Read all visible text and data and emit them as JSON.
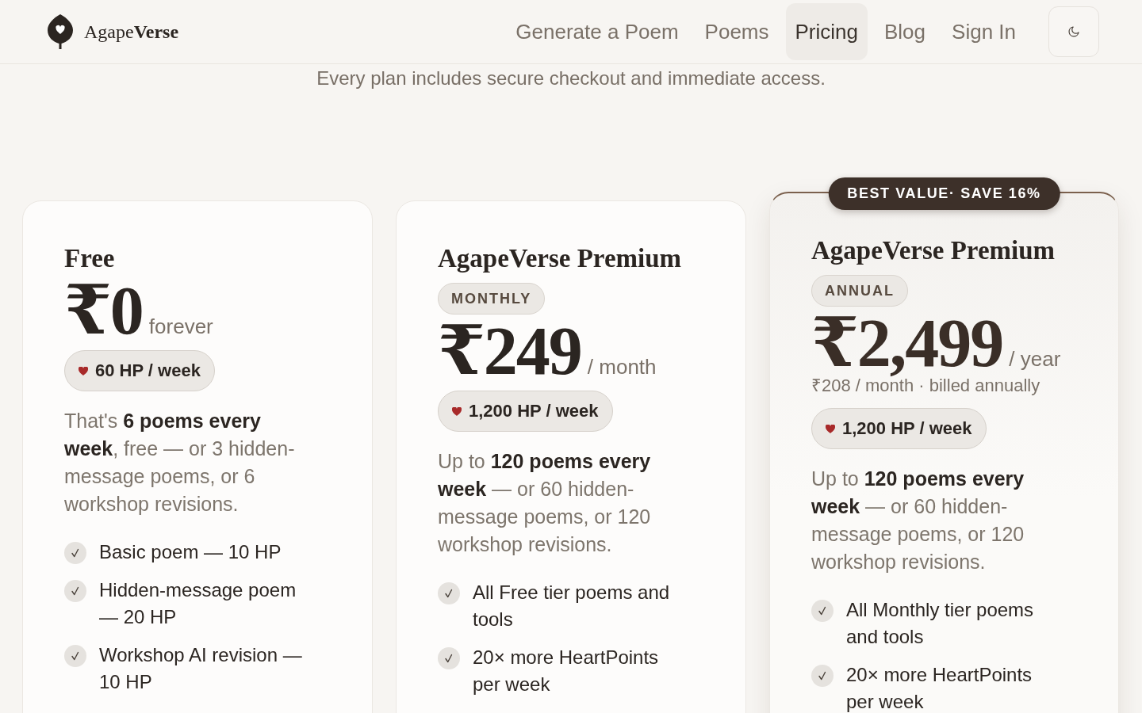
{
  "header": {
    "logo": "Agape**Verse**",
    "nav": [
      {
        "label": "Generate a Poem",
        "selected": false
      },
      {
        "label": "Poems",
        "selected": false
      },
      {
        "label": "Pricing",
        "selected": true
      },
      {
        "label": "Blog",
        "selected": false
      },
      {
        "label": "Sign In",
        "selected": false
      }
    ]
  },
  "subtitle": "Every plan includes secure checkout and immediate access.",
  "plans": [
    {
      "name": "Free",
      "featured": false,
      "price": "₹0",
      "period": "forever",
      "allowance": "60 HP / week",
      "description": "That's **6 poems every week**, free — or 3 hidden-message poems, or 6 workshop revisions.",
      "features": [
        "Basic poem — 10 HP",
        "Hidden-message poem — 20 HP",
        "Workshop AI revision — 10 HP"
      ]
    },
    {
      "name": "AgapeVerse Premium",
      "featured": false,
      "billing_tag": "MONTHLY",
      "price": "₹249",
      "period": "/ month",
      "allowance": "1,200 HP / week",
      "description": "Up to **120 poems every week** — or 60 hidden-message poems, or 120 workshop revisions.",
      "features": [
        "All Free tier poems and tools",
        "20× more HeartPoints per week"
      ]
    },
    {
      "name": "AgapeVerse Premium",
      "featured": true,
      "ribbon": "BEST VALUE· SAVE 16%",
      "billing_tag": "ANNUAL",
      "price": "₹2,499",
      "period": "/ year",
      "billing_note": "₹208 / month · billed annually",
      "allowance": "1,200 HP / week",
      "description": "Up to **120 poems every week** — or 60 hidden-message poems, or 120 workshop revisions.",
      "features": [
        "All Monthly tier poems and tools",
        "20× more HeartPoints per week"
      ]
    }
  ]
}
